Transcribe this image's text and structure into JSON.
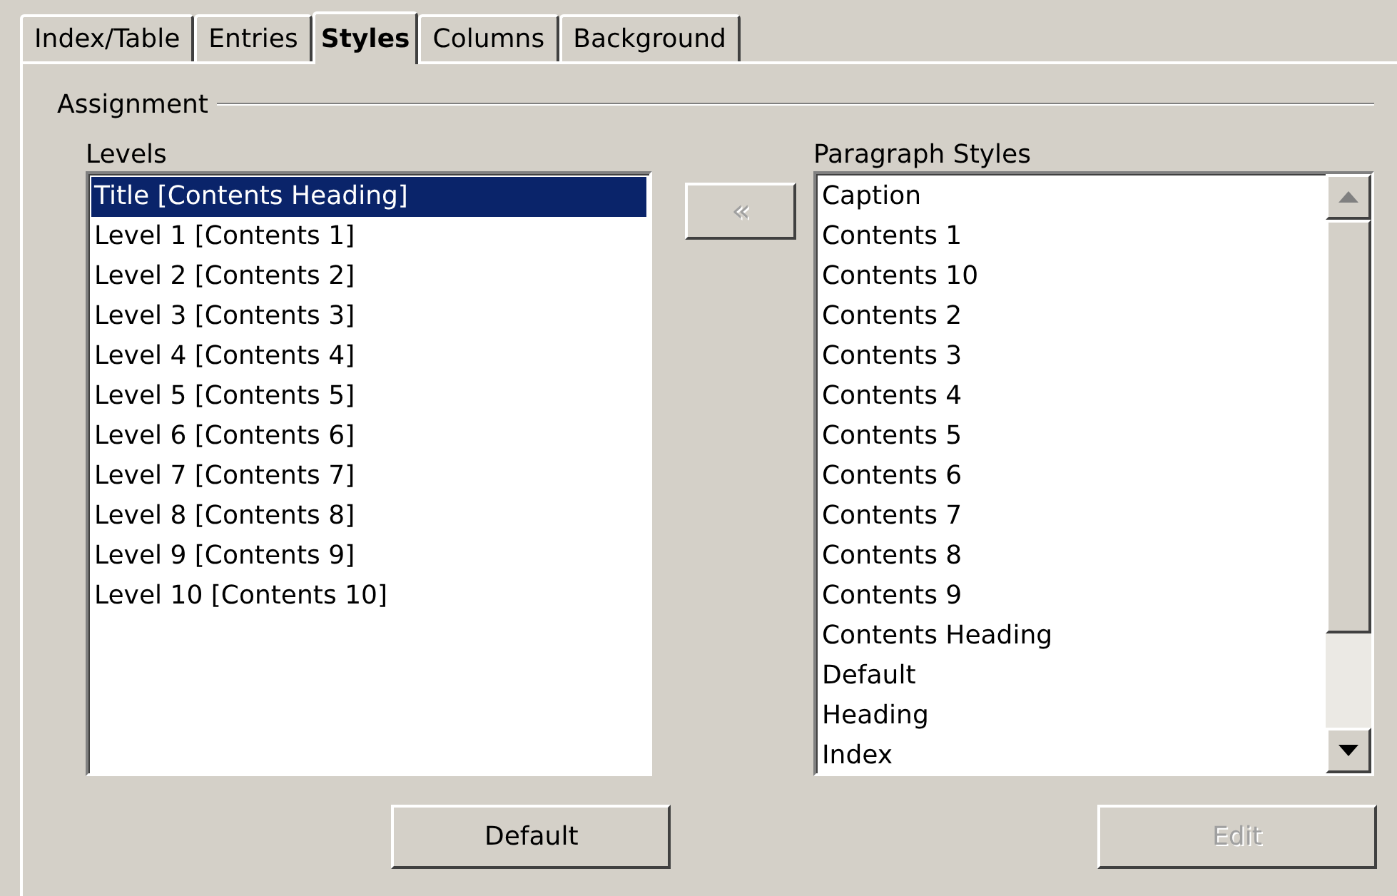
{
  "tabs": [
    {
      "label": "Index/Table",
      "selected": false
    },
    {
      "label": "Entries",
      "selected": false
    },
    {
      "label": "Styles",
      "selected": true
    },
    {
      "label": "Columns",
      "selected": false
    },
    {
      "label": "Background",
      "selected": false
    }
  ],
  "assignment": {
    "title": "Assignment",
    "levels": {
      "label": "Levels",
      "items": [
        {
          "text": "Title [Contents Heading]",
          "selected": true
        },
        {
          "text": "Level 1 [Contents 1]",
          "selected": false
        },
        {
          "text": "Level 2 [Contents 2]",
          "selected": false
        },
        {
          "text": "Level 3 [Contents 3]",
          "selected": false
        },
        {
          "text": "Level 4 [Contents 4]",
          "selected": false
        },
        {
          "text": "Level 5 [Contents 5]",
          "selected": false
        },
        {
          "text": "Level 6 [Contents 6]",
          "selected": false
        },
        {
          "text": "Level 7 [Contents 7]",
          "selected": false
        },
        {
          "text": "Level 8 [Contents 8]",
          "selected": false
        },
        {
          "text": "Level 9 [Contents 9]",
          "selected": false
        },
        {
          "text": "Level 10 [Contents 10]",
          "selected": false
        }
      ]
    },
    "assign_button": {
      "label": "«",
      "disabled": true
    },
    "paragraph_styles": {
      "label": "Paragraph Styles",
      "items": [
        {
          "text": "Caption",
          "selected": false
        },
        {
          "text": "Contents 1",
          "selected": false
        },
        {
          "text": "Contents 10",
          "selected": false
        },
        {
          "text": "Contents 2",
          "selected": false
        },
        {
          "text": "Contents 3",
          "selected": false
        },
        {
          "text": "Contents 4",
          "selected": false
        },
        {
          "text": "Contents 5",
          "selected": false
        },
        {
          "text": "Contents 6",
          "selected": false
        },
        {
          "text": "Contents 7",
          "selected": false
        },
        {
          "text": "Contents 8",
          "selected": false
        },
        {
          "text": "Contents 9",
          "selected": false
        },
        {
          "text": "Contents Heading",
          "selected": false
        },
        {
          "text": "Default",
          "selected": false
        },
        {
          "text": "Heading",
          "selected": false
        },
        {
          "text": "Index",
          "selected": false
        }
      ]
    },
    "default_button": {
      "label": "Default",
      "disabled": false
    },
    "edit_button": {
      "label": "Edit",
      "disabled": true
    }
  }
}
